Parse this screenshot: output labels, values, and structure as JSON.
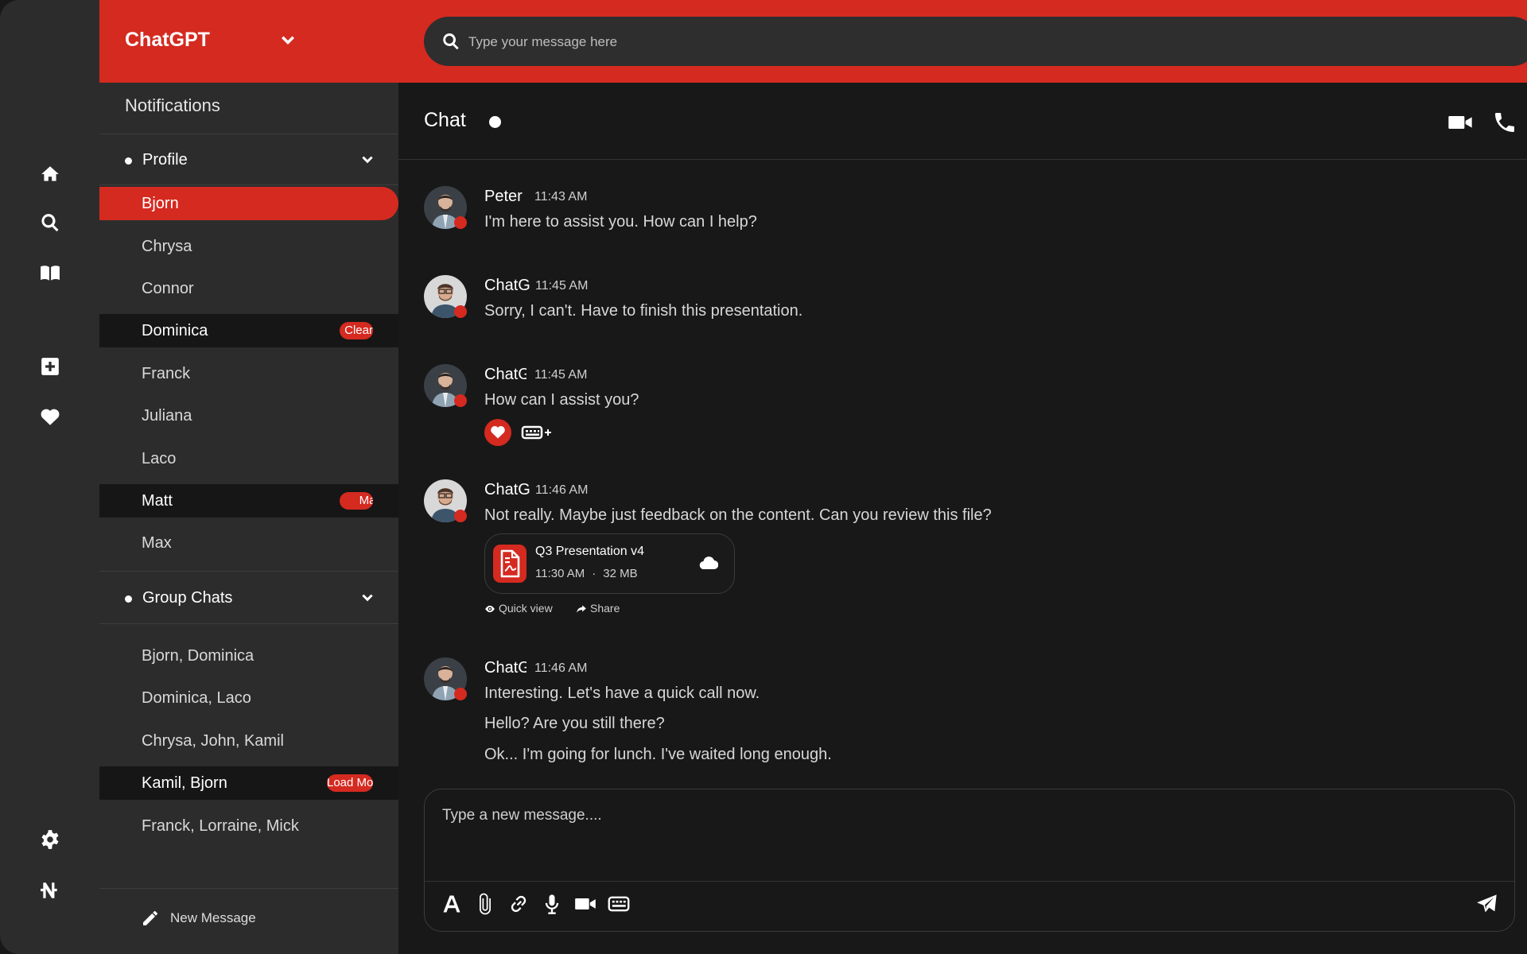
{
  "app": {
    "brand": "ChatGPT",
    "accent_color": "#d42a20"
  },
  "search": {
    "placeholder": "Type your message here"
  },
  "rail": {
    "icons": [
      "home-icon",
      "search-icon",
      "book-icon",
      "add-square-icon",
      "heart-icon",
      "settings-icon",
      "currency-icon"
    ]
  },
  "sidebar": {
    "notifications": "Notifications",
    "profile_section": "Profile",
    "contacts": [
      {
        "name": "Bjorn",
        "state": "active",
        "badge": ""
      },
      {
        "name": "Chrysa",
        "state": "normal",
        "badge": ""
      },
      {
        "name": "Connor",
        "state": "normal",
        "badge": ""
      },
      {
        "name": "Dominica",
        "state": "highlight",
        "badge": "Clear"
      },
      {
        "name": "Franck",
        "state": "normal",
        "badge": ""
      },
      {
        "name": "Juliana",
        "state": "normal",
        "badge": ""
      },
      {
        "name": "Laco",
        "state": "normal",
        "badge": ""
      },
      {
        "name": "Matt",
        "state": "highlight",
        "badge": "Mark All"
      },
      {
        "name": "Max",
        "state": "normal",
        "badge": ""
      }
    ],
    "group_section": "Group Chats",
    "groups": [
      {
        "name": "Bjorn, Dominica",
        "state": "normal",
        "badge": ""
      },
      {
        "name": "Dominica, Laco",
        "state": "normal",
        "badge": ""
      },
      {
        "name": "Chrysa, John, Kamil",
        "state": "normal",
        "badge": ""
      },
      {
        "name": "Kamil, Bjorn",
        "state": "highlight",
        "badge": "Load More"
      },
      {
        "name": "Franck, Lorraine, Mick",
        "state": "normal",
        "badge": ""
      }
    ],
    "new_message": "New Message"
  },
  "chat": {
    "title": "Chat",
    "messages": [
      {
        "sender": "Peter",
        "time": "11:43 AM",
        "lines": [
          "I'm here to assist you. How can I help?"
        ]
      },
      {
        "sender": "ChatG",
        "time": "11:45 AM",
        "lines": [
          "Sorry, I can't. Have to finish this presentation."
        ]
      },
      {
        "sender": "ChatG",
        "time": "11:45 AM",
        "lines": [
          "How can I assist you?"
        ]
      },
      {
        "sender": "ChatG",
        "time": "11:46 AM",
        "lines": [
          "Not really. Maybe just feedback on the content. Can you review this file?"
        ]
      },
      {
        "sender": "ChatG",
        "time": "11:46 AM",
        "lines": [
          "Interesting. Let's have a quick call now.",
          "Hello? Are you still there?",
          "Ok... I'm going for lunch. I've waited long enough."
        ]
      }
    ],
    "file": {
      "name": "Q3 Presentation v4",
      "time": "11:30 AM",
      "size": "32 MB",
      "quick_view": "Quick view",
      "share": "Share"
    }
  },
  "composer": {
    "placeholder": "Type a new message...."
  }
}
